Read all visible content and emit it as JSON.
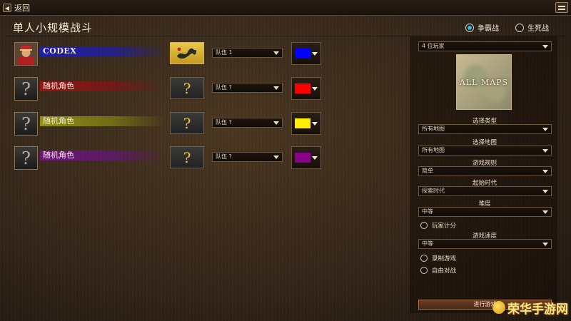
{
  "topbar": {
    "back_label": "返回"
  },
  "page": {
    "title": "单人小规模战斗"
  },
  "modes": [
    {
      "label": "争霸战",
      "selected": true
    },
    {
      "label": "生死战",
      "selected": false
    }
  ],
  "players": [
    {
      "name": "CODEX",
      "portrait": "leader-portrait",
      "civ_icon": "dragon-icon",
      "team": "队伍 1",
      "color": "#0000ff"
    },
    {
      "name": "随机角色",
      "portrait": "?",
      "civ_icon": "?",
      "team": "队伍 ?",
      "color": "#ff0000"
    },
    {
      "name": "随机角色",
      "portrait": "?",
      "civ_icon": "?",
      "team": "队伍 ?",
      "color": "#ffee00"
    },
    {
      "name": "随机角色",
      "portrait": "?",
      "civ_icon": "?",
      "team": "队伍 ?",
      "color": "#8b008b"
    }
  ],
  "settings": {
    "player_count": "4 位玩家",
    "map_preview_text": "ALL MAPS",
    "map_type_label": "选择类型",
    "map_type_value": "所有地图",
    "map_label": "选择地图",
    "map_value": "所有地图",
    "rules_label": "游戏规则",
    "rules_value": "简单",
    "start_age_label": "起始时代",
    "start_age_value": "探索时代",
    "difficulty_label": "难度",
    "difficulty_value": "中等",
    "score_label": "玩家计分",
    "speed_label": "游戏速度",
    "speed_value": "中等",
    "record_label": "录制游戏",
    "freeforall_label": "自由对战",
    "start_label": "进行游戏"
  },
  "watermark": {
    "text": "荣华手游网"
  },
  "colors": {
    "team_blue": "#0000ff",
    "team_red": "#ff0000",
    "team_yellow": "#ffee00",
    "team_purple": "#8b008b",
    "accent_radio": "#2fb8e0"
  }
}
